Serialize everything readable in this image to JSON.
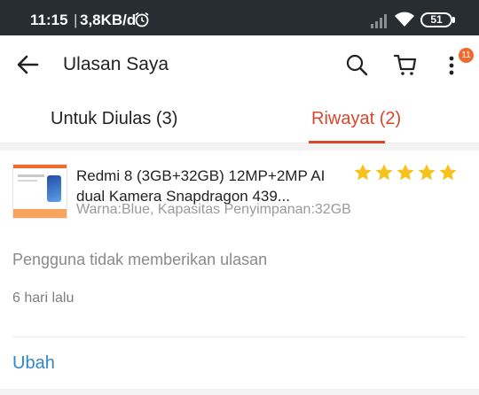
{
  "status_bar": {
    "time": "11:15",
    "separator": "|",
    "network_speed": "3,8KB/d",
    "battery": "51"
  },
  "app_bar": {
    "title": "Ulasan Saya",
    "cart_badge_count": "11"
  },
  "tabs": [
    {
      "label": "Untuk Diulas (3)",
      "active": false
    },
    {
      "label": "Riwayat (2)",
      "active": true
    }
  ],
  "review": {
    "product_name": "Redmi 8 (3GB+32GB) 12MP+2MP AI dual Kamera Snapdragon 439...",
    "variant": "Warna:Blue, Kapasitas Penyimpanan:32GB",
    "rating": 5,
    "review_text": "Pengguna tidak memberikan ulasan",
    "date": "6  hari lalu",
    "edit_label": "Ubah"
  },
  "colors": {
    "accent": "#d9472b",
    "star": "#f6c21c",
    "link": "#2f86c9",
    "badge": "#ee6a2f",
    "status_bar": "#272d31"
  },
  "icons": {
    "back": "back-arrow-icon",
    "search": "search-icon",
    "cart": "cart-icon",
    "more": "more-vert-icon"
  }
}
